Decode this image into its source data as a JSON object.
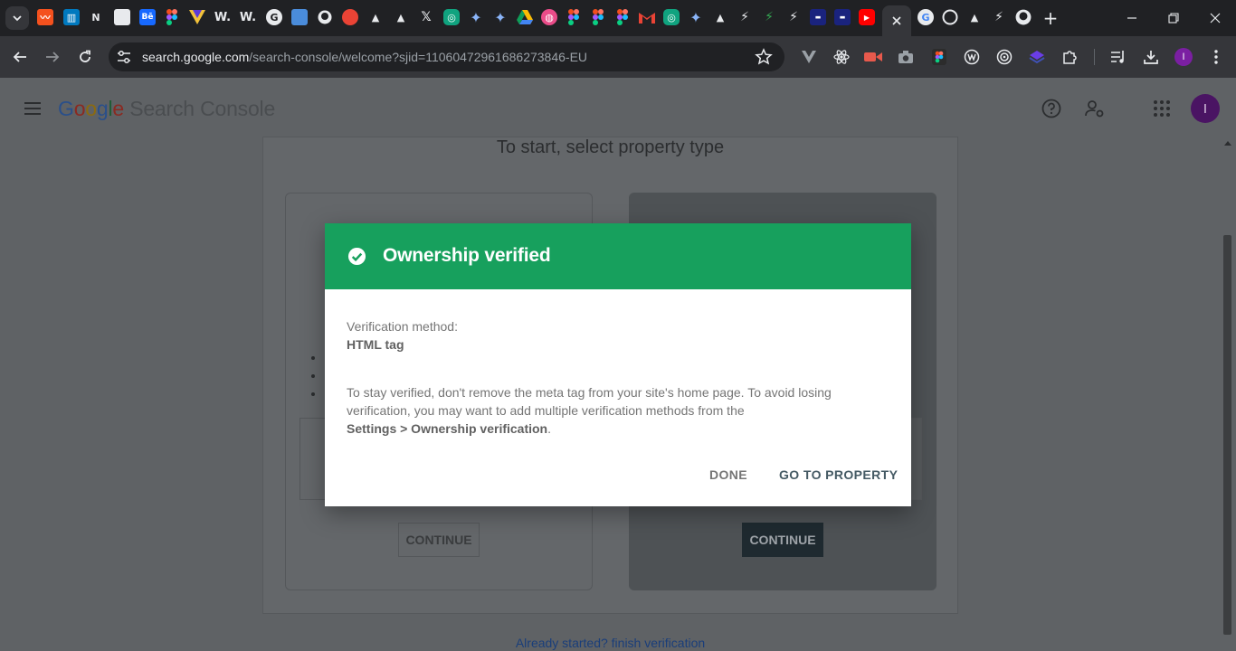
{
  "browser": {
    "address_host": "search.google.com",
    "address_path": "/search-console/welcome?sjid=11060472961686273846-EU",
    "profile_initial": "I",
    "tab_icons": [
      "chrome-icon",
      "trello-icon",
      "notion-icon",
      "file-icon",
      "behance-icon",
      "figma-icon",
      "vuetify-icon",
      "webflow-icon",
      "webflow-icon",
      "google-icon",
      "cube-icon",
      "github-icon",
      "pacman-icon",
      "vercel-icon",
      "vercel-icon",
      "x-icon",
      "chatgpt-icon",
      "gemini-icon",
      "gemini-icon",
      "drive-icon",
      "dribbble-icon",
      "figma-icon",
      "figma-icon",
      "figma-icon",
      "gmail-icon",
      "chatgpt-icon",
      "gemini-icon",
      "vercel-icon",
      "bolt-icon",
      "bolt-icon",
      "bolt-icon",
      "app-icon",
      "app-icon",
      "youtube-icon",
      "google-icon",
      "circle-icon",
      "vercel-icon",
      "bolt-icon",
      "github-icon"
    ],
    "new_tab": "+"
  },
  "app": {
    "product_name": "Search Console",
    "logo": [
      "G",
      "o",
      "o",
      "g",
      "l",
      "e"
    ],
    "avatar_initial": "I"
  },
  "page": {
    "title": "To start, select property type",
    "continue_left": "CONTINUE",
    "continue_right": "CONTINUE",
    "already_started_link": "Already started? finish verification"
  },
  "modal": {
    "title": "Ownership verified",
    "method_label": "Verification method:",
    "method_value": "HTML tag",
    "description": "To stay verified, don't remove the meta tag from your site's home page. To avoid losing verification, you may want to add multiple verification methods from the",
    "settings_path": "Settings > Ownership verification",
    "description_end": ".",
    "done_label": "DONE",
    "goto_label": "GO TO PROPERTY"
  },
  "colors": {
    "success_header": "#17a05d",
    "primary_action": "#455a64"
  }
}
